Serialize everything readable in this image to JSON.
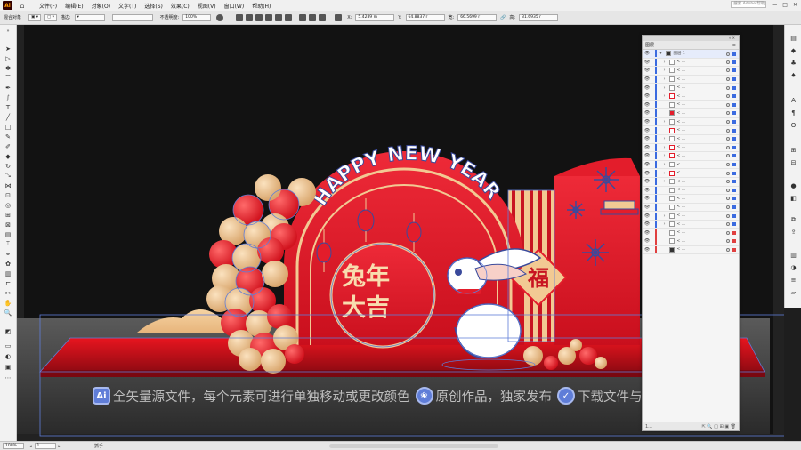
{
  "menubar": {
    "app_logo": "Ai",
    "items": [
      "文件(F)",
      "编辑(E)",
      "对象(O)",
      "文字(T)",
      "选择(S)",
      "效果(C)",
      "视图(V)",
      "窗口(W)",
      "帮助(H)"
    ],
    "search_placeholder": "搜索 Adobe 帮助"
  },
  "controlbar": {
    "object_type": "混合对象",
    "stroke_label": "描边:",
    "opacity_label": "不透明度:",
    "opacity_value": "100%",
    "x_value": "5.4289 m",
    "y_value": "64.8837 r",
    "w_value": "66.5699 r",
    "h_value": "31.6935 r"
  },
  "artwork": {
    "headline": "HAPPY NEW YEAR",
    "circle_text_line1": "兔年",
    "circle_text_line2": "大吉",
    "fu_char": "福",
    "colors": {
      "red": "#e31d2b",
      "gold": "#f2c993",
      "navy": "#3a4a9c",
      "floor": "#c30d1d"
    }
  },
  "banner": {
    "ai_badge": "Ai",
    "text1": "全矢量源文件，每个元素可进行单独移动或更改颜色",
    "text2": "原创作品，独家发布",
    "text3": "下载文件与预"
  },
  "layers_panel": {
    "title": "图层",
    "layer_name": "图层 1",
    "sublayer_label": "< ...",
    "footer_label": "1..."
  },
  "statusbar": {
    "zoom": "100%",
    "artboard_number": "1",
    "tool_name": "抓手"
  }
}
